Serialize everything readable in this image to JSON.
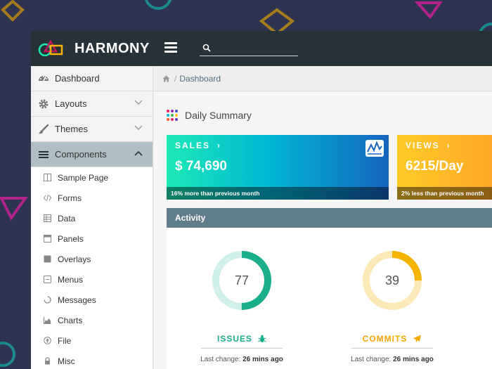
{
  "brand": {
    "name": "HARMONY"
  },
  "search": {
    "placeholder": ""
  },
  "sidebar": {
    "items": [
      {
        "label": "Dashboard"
      },
      {
        "label": "Layouts"
      },
      {
        "label": "Themes"
      },
      {
        "label": "Components"
      }
    ],
    "sub_items": [
      {
        "label": "Sample Page"
      },
      {
        "label": "Forms"
      },
      {
        "label": "Data"
      },
      {
        "label": "Panels"
      },
      {
        "label": "Overlays"
      },
      {
        "label": "Menus"
      },
      {
        "label": "Messages"
      },
      {
        "label": "Charts"
      },
      {
        "label": "File"
      },
      {
        "label": "Misc"
      }
    ]
  },
  "breadcrumb": {
    "separator": "/",
    "current": "Dashboard"
  },
  "summary": {
    "title": "Daily Summary"
  },
  "cards": {
    "sales": {
      "label": "SALES",
      "arrow": "›",
      "value": "$ 74,690",
      "footer": "16% more than previous month"
    },
    "views": {
      "label": "VIEWS",
      "arrow": "›",
      "value": "6215/Day",
      "footer": "2% less than previous month"
    }
  },
  "activity": {
    "title": "Activity",
    "issues": {
      "value": "77",
      "percent": 50,
      "label": "ISSUES",
      "change_prefix": "Last change:",
      "change_value": "26 mins ago",
      "color": "#1aae8c",
      "track": "#d1f0ea"
    },
    "commits": {
      "value": "39",
      "percent": 25,
      "label": "COMMITS",
      "change_prefix": "Last change:",
      "change_value": "26 mins ago",
      "color": "#f5b400",
      "track": "#fde8b8"
    }
  },
  "colors": {
    "topbar": "#263238",
    "activity_header": "#607d8b",
    "active_nav": "#b0bec5",
    "page_bg": "#2e3350"
  }
}
